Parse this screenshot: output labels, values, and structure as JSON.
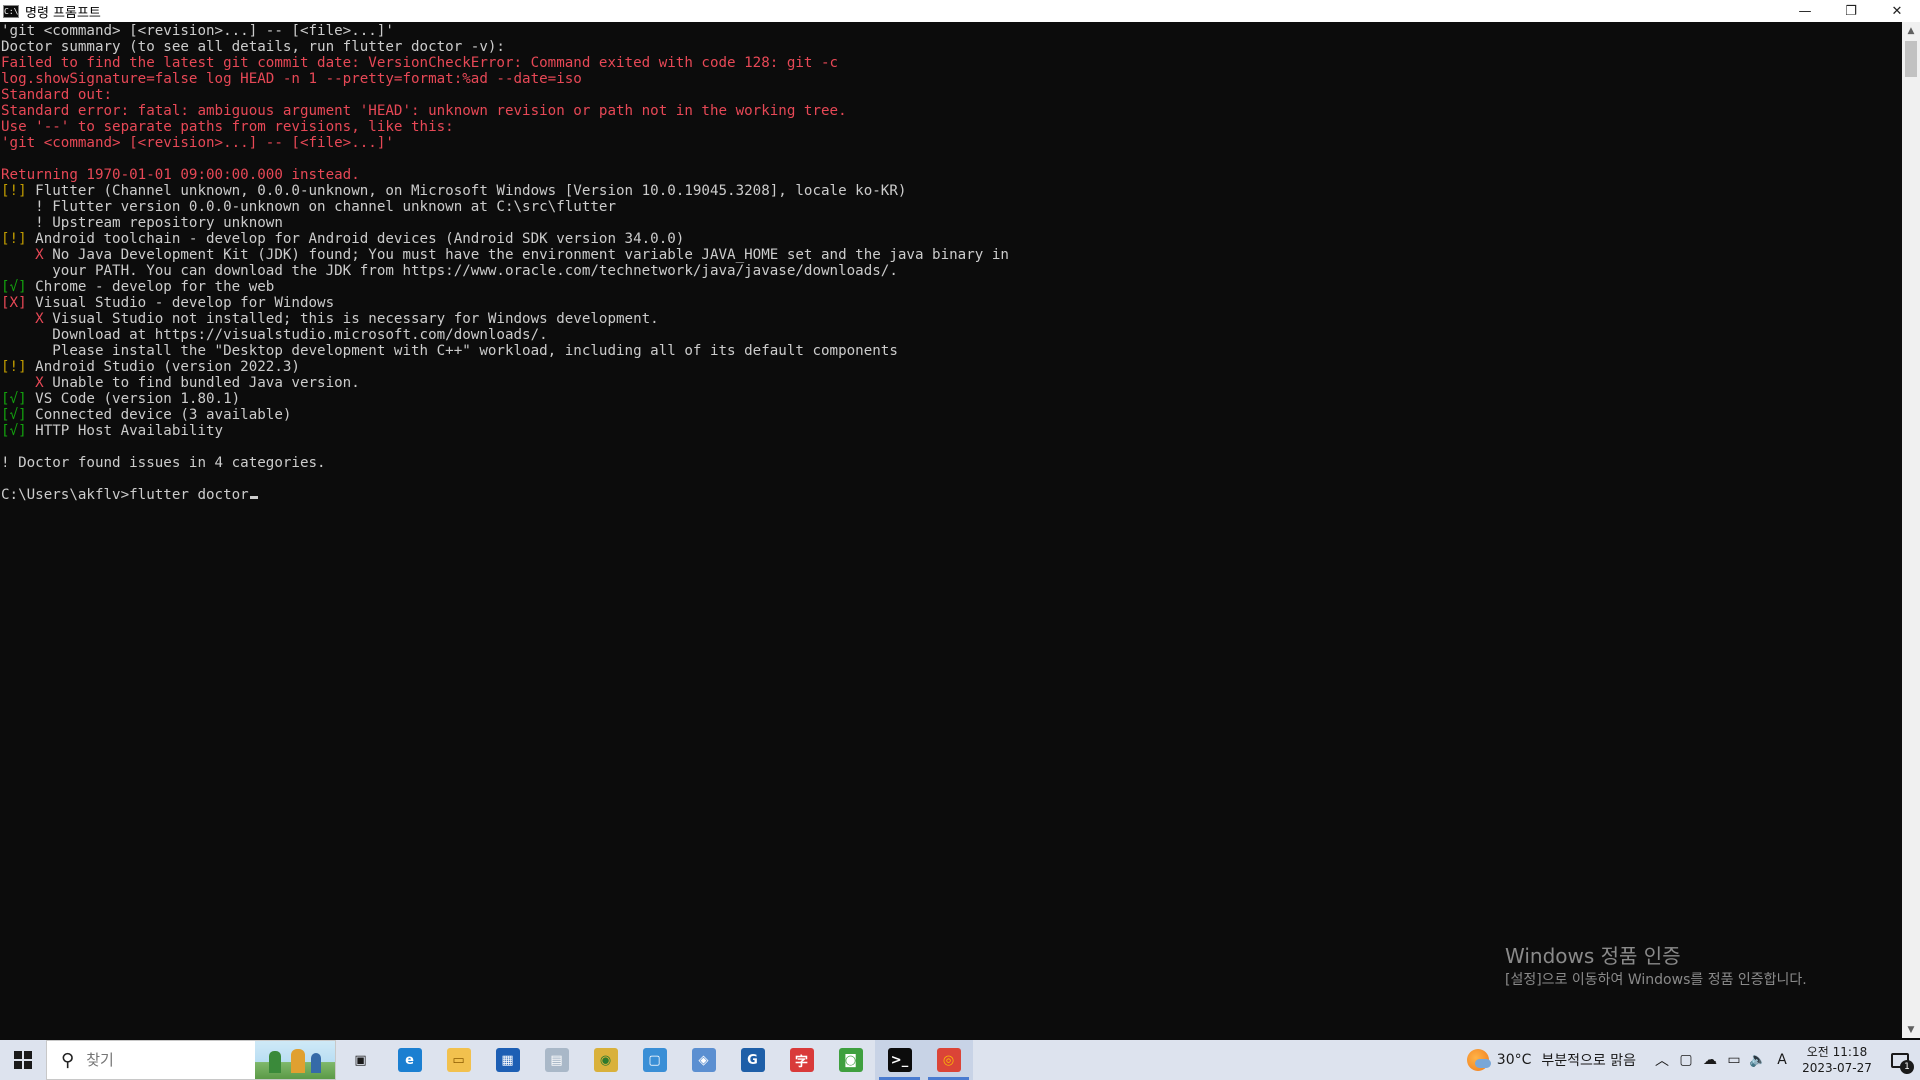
{
  "window": {
    "title": "명령 프롬프트",
    "minimize_glyph": "—",
    "restore_glyph": "❐",
    "close_glyph": "✕"
  },
  "console": {
    "lines": [
      {
        "text": "'git <command> [<revision>...] -- [<file>...]'",
        "color": "white"
      },
      {
        "text": "Doctor summary (to see all details, run flutter doctor -v):",
        "color": "white"
      },
      {
        "text": "Failed to find the latest git commit date: VersionCheckError: Command exited with code 128: git -c",
        "color": "red"
      },
      {
        "text": "log.showSignature=false log HEAD -n 1 --pretty=format:%ad --date=iso",
        "color": "red"
      },
      {
        "text": "Standard out:",
        "color": "red"
      },
      {
        "text": "Standard error: fatal: ambiguous argument 'HEAD': unknown revision or path not in the working tree.",
        "color": "red"
      },
      {
        "text": "Use '--' to separate paths from revisions, like this:",
        "color": "red"
      },
      {
        "text": "'git <command> [<revision>...] -- [<file>...]'",
        "color": "red"
      },
      {
        "text": "",
        "color": "white"
      },
      {
        "text": "Returning 1970-01-01 09:00:00.000 instead.",
        "color": "red"
      },
      {
        "parts": [
          {
            "text": "[!]",
            "color": "yellow"
          },
          {
            "text": " Flutter (Channel unknown, 0.0.0-unknown, on Microsoft Windows [Version 10.0.19045.3208], locale ko-KR)",
            "color": "white"
          }
        ]
      },
      {
        "parts": [
          {
            "text": "    ! Flutter version 0.0.0-unknown on channel unknown at C:\\src\\flutter",
            "color": "white"
          }
        ]
      },
      {
        "parts": [
          {
            "text": "    ! Upstream repository unknown",
            "color": "white"
          }
        ]
      },
      {
        "parts": [
          {
            "text": "[!]",
            "color": "yellow"
          },
          {
            "text": " Android toolchain - develop for Android devices (Android SDK version 34.0.0)",
            "color": "white"
          }
        ]
      },
      {
        "parts": [
          {
            "text": "    X",
            "color": "red"
          },
          {
            "text": " No Java Development Kit (JDK) found; You must have the environment variable JAVA_HOME set and the java binary in",
            "color": "white"
          }
        ]
      },
      {
        "parts": [
          {
            "text": "      your PATH. You can download the JDK from https://www.oracle.com/technetwork/java/javase/downloads/.",
            "color": "white"
          }
        ]
      },
      {
        "parts": [
          {
            "text": "[√]",
            "color": "green"
          },
          {
            "text": " Chrome - develop for the web",
            "color": "white"
          }
        ]
      },
      {
        "parts": [
          {
            "text": "[X]",
            "color": "red"
          },
          {
            "text": " Visual Studio - develop for Windows",
            "color": "white"
          }
        ]
      },
      {
        "parts": [
          {
            "text": "    X",
            "color": "red"
          },
          {
            "text": " Visual Studio not installed; this is necessary for Windows development.",
            "color": "white"
          }
        ]
      },
      {
        "parts": [
          {
            "text": "      Download at https://visualstudio.microsoft.com/downloads/.",
            "color": "white"
          }
        ]
      },
      {
        "parts": [
          {
            "text": "      Please install the \"Desktop development with C++\" workload, including all of its default components",
            "color": "white"
          }
        ]
      },
      {
        "parts": [
          {
            "text": "[!]",
            "color": "yellow"
          },
          {
            "text": " Android Studio (version 2022.3)",
            "color": "white"
          }
        ]
      },
      {
        "parts": [
          {
            "text": "    X",
            "color": "red"
          },
          {
            "text": " Unable to find bundled Java version.",
            "color": "white"
          }
        ]
      },
      {
        "parts": [
          {
            "text": "[√]",
            "color": "green"
          },
          {
            "text": " VS Code (version 1.80.1)",
            "color": "white"
          }
        ]
      },
      {
        "parts": [
          {
            "text": "[√]",
            "color": "green"
          },
          {
            "text": " Connected device (3 available)",
            "color": "white"
          }
        ]
      },
      {
        "parts": [
          {
            "text": "[√]",
            "color": "green"
          },
          {
            "text": " HTTP Host Availability",
            "color": "white"
          }
        ]
      },
      {
        "text": "",
        "color": "white"
      },
      {
        "text": "! Doctor found issues in 4 categories.",
        "color": "white"
      },
      {
        "text": "",
        "color": "white"
      }
    ],
    "prompt": "C:\\Users\\akflv>",
    "command": "flutter doctor"
  },
  "scrollbar": {
    "up_glyph": "▲",
    "down_glyph": "▼"
  },
  "watermark": {
    "title": "Windows 정품 인증",
    "subtitle": "[설정]으로 이동하여 Windows를 정품 인증합니다."
  },
  "taskbar": {
    "search_placeholder": "찾기",
    "search_icon": "search-icon",
    "apps": [
      {
        "name": "task-view-icon",
        "glyph": "▣",
        "bg": "transparent",
        "fg": "#1a1a1a"
      },
      {
        "name": "edge-icon",
        "glyph": "e",
        "bg": "#1b7fd1",
        "fg": "#ffffff"
      },
      {
        "name": "file-explorer-icon",
        "glyph": "▭",
        "bg": "#f2c14e",
        "fg": "#8a5a00"
      },
      {
        "name": "store-icon",
        "glyph": "▦",
        "bg": "#1d5fb4",
        "fg": "#ffffff"
      },
      {
        "name": "photos-icon",
        "glyph": "▤",
        "bg": "#a9b8c8",
        "fg": "#ffffff"
      },
      {
        "name": "maps-icon",
        "glyph": "◉",
        "bg": "#d9b13b",
        "fg": "#2d7a2d"
      },
      {
        "name": "remote-desktop-icon",
        "glyph": "▢",
        "bg": "#3a8fd6",
        "fg": "#ffffff"
      },
      {
        "name": "network-icon",
        "glyph": "◈",
        "bg": "#5b8fd1",
        "fg": "#ffffff"
      },
      {
        "name": "grammarly-icon",
        "glyph": "G",
        "bg": "#1e5fa8",
        "fg": "#ffffff"
      },
      {
        "name": "dictionary-icon",
        "glyph": "字",
        "bg": "#d93a3a",
        "fg": "#ffffff"
      },
      {
        "name": "nvidia-icon",
        "glyph": "◙",
        "bg": "#3fa03f",
        "fg": "#ffffff"
      },
      {
        "name": "terminal-icon",
        "glyph": ">_",
        "bg": "#0c0c0c",
        "fg": "#ffffff"
      },
      {
        "name": "chrome-icon",
        "glyph": "◎",
        "bg": "#db4437",
        "fg": "#fbbc05"
      }
    ],
    "active_apps": [
      "terminal-icon",
      "chrome-icon"
    ],
    "weather": {
      "temp": "30°C",
      "condition": "부분적으로 맑음"
    },
    "tray_icons": [
      {
        "name": "chevron-up-icon",
        "glyph": "︿"
      },
      {
        "name": "meet-icon",
        "glyph": "▢"
      },
      {
        "name": "onedrive-icon",
        "glyph": "☁"
      },
      {
        "name": "network-status-icon",
        "glyph": "▭"
      },
      {
        "name": "volume-icon",
        "glyph": "🔈"
      },
      {
        "name": "ime-icon",
        "glyph": "A"
      }
    ],
    "clock": {
      "time": "오전 11:18",
      "date": "2023-07-27"
    },
    "notification_count": "1"
  },
  "colors": {
    "console_bg": "#0c0c0c",
    "text_default": "#cccccc",
    "text_red": "#e74856",
    "text_yellow": "#c19c00",
    "text_green": "#13a10e",
    "taskbar_bg": "#dde3ee"
  }
}
